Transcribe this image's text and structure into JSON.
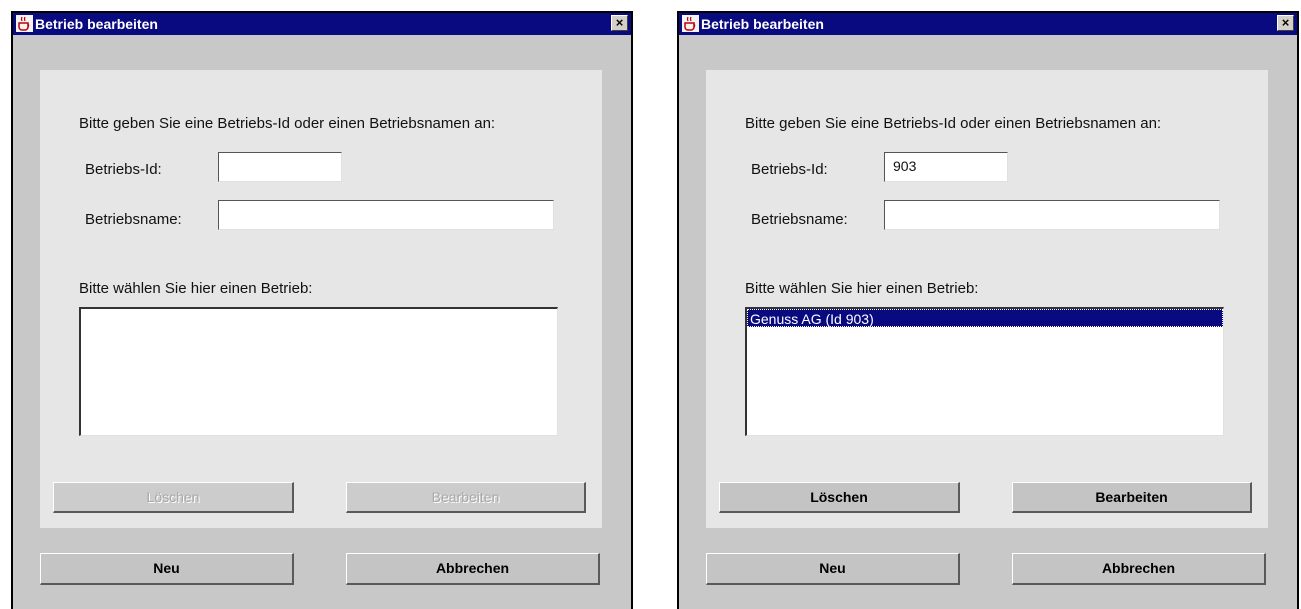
{
  "windows": [
    {
      "title": "Betrieb bearbeiten",
      "close_label": "×",
      "prompt": "Bitte geben Sie eine Betriebs-Id oder einen Betriebsnamen an:",
      "id_label": "Betriebs-Id:",
      "id_value": "",
      "name_label": "Betriebsname:",
      "name_value": "",
      "list_label": "Bitte wählen Sie hier einen Betrieb:",
      "list_items": [],
      "delete_button": "Löschen",
      "edit_button": "Bearbeiten",
      "delete_enabled": false,
      "edit_enabled": false,
      "new_button": "Neu",
      "cancel_button": "Abbrechen"
    },
    {
      "title": "Betrieb bearbeiten",
      "close_label": "×",
      "prompt": "Bitte geben Sie eine Betriebs-Id oder einen Betriebsnamen an:",
      "id_label": "Betriebs-Id:",
      "id_value": "903",
      "name_label": "Betriebsname:",
      "name_value": "",
      "list_label": "Bitte wählen Sie hier einen Betrieb:",
      "list_items": [
        "Genuss AG (Id 903)"
      ],
      "selected_item": "Genuss AG (Id 903)",
      "delete_button": "Löschen",
      "edit_button": "Bearbeiten",
      "delete_enabled": true,
      "edit_enabled": true,
      "new_button": "Neu",
      "cancel_button": "Abbrechen"
    }
  ]
}
